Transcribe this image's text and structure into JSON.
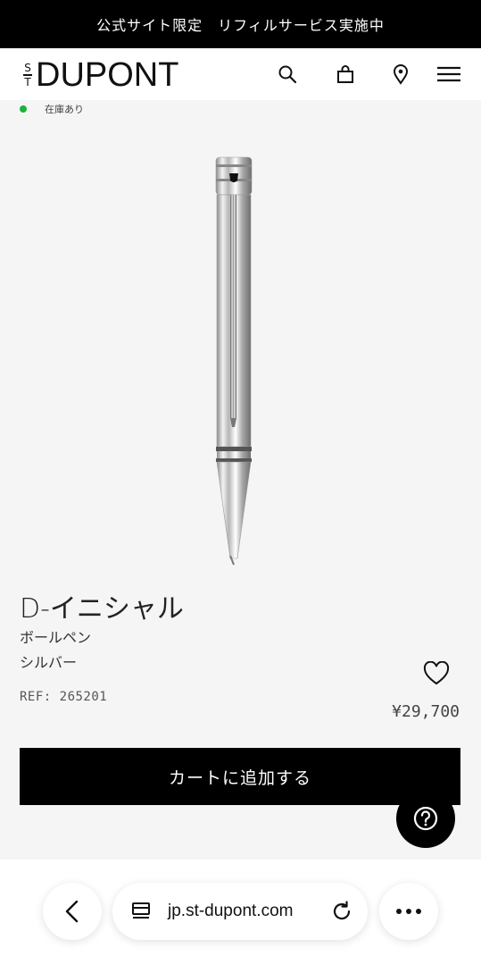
{
  "promo": {
    "text": "公式サイト限定　リフィルサービス実施中"
  },
  "header": {
    "logo_small": [
      "S",
      "T"
    ],
    "logo_word": "DUPONT",
    "icons": [
      "search-icon",
      "bag-icon",
      "location-pin-icon",
      "menu-icon"
    ]
  },
  "stock": {
    "label": "在庫あり",
    "color": "#1bb33a"
  },
  "product": {
    "title": "D-イニシャル",
    "type": "ボールペン",
    "color": "シルバー",
    "ref": "REF: 265201",
    "price": "¥29,700",
    "cta": "カートに追加する"
  },
  "help": {
    "icon": "question-icon"
  },
  "browser": {
    "url": "jp.st-dupont.com",
    "icons": [
      "back-icon",
      "tabs-icon",
      "reload-icon",
      "more-icon"
    ]
  }
}
